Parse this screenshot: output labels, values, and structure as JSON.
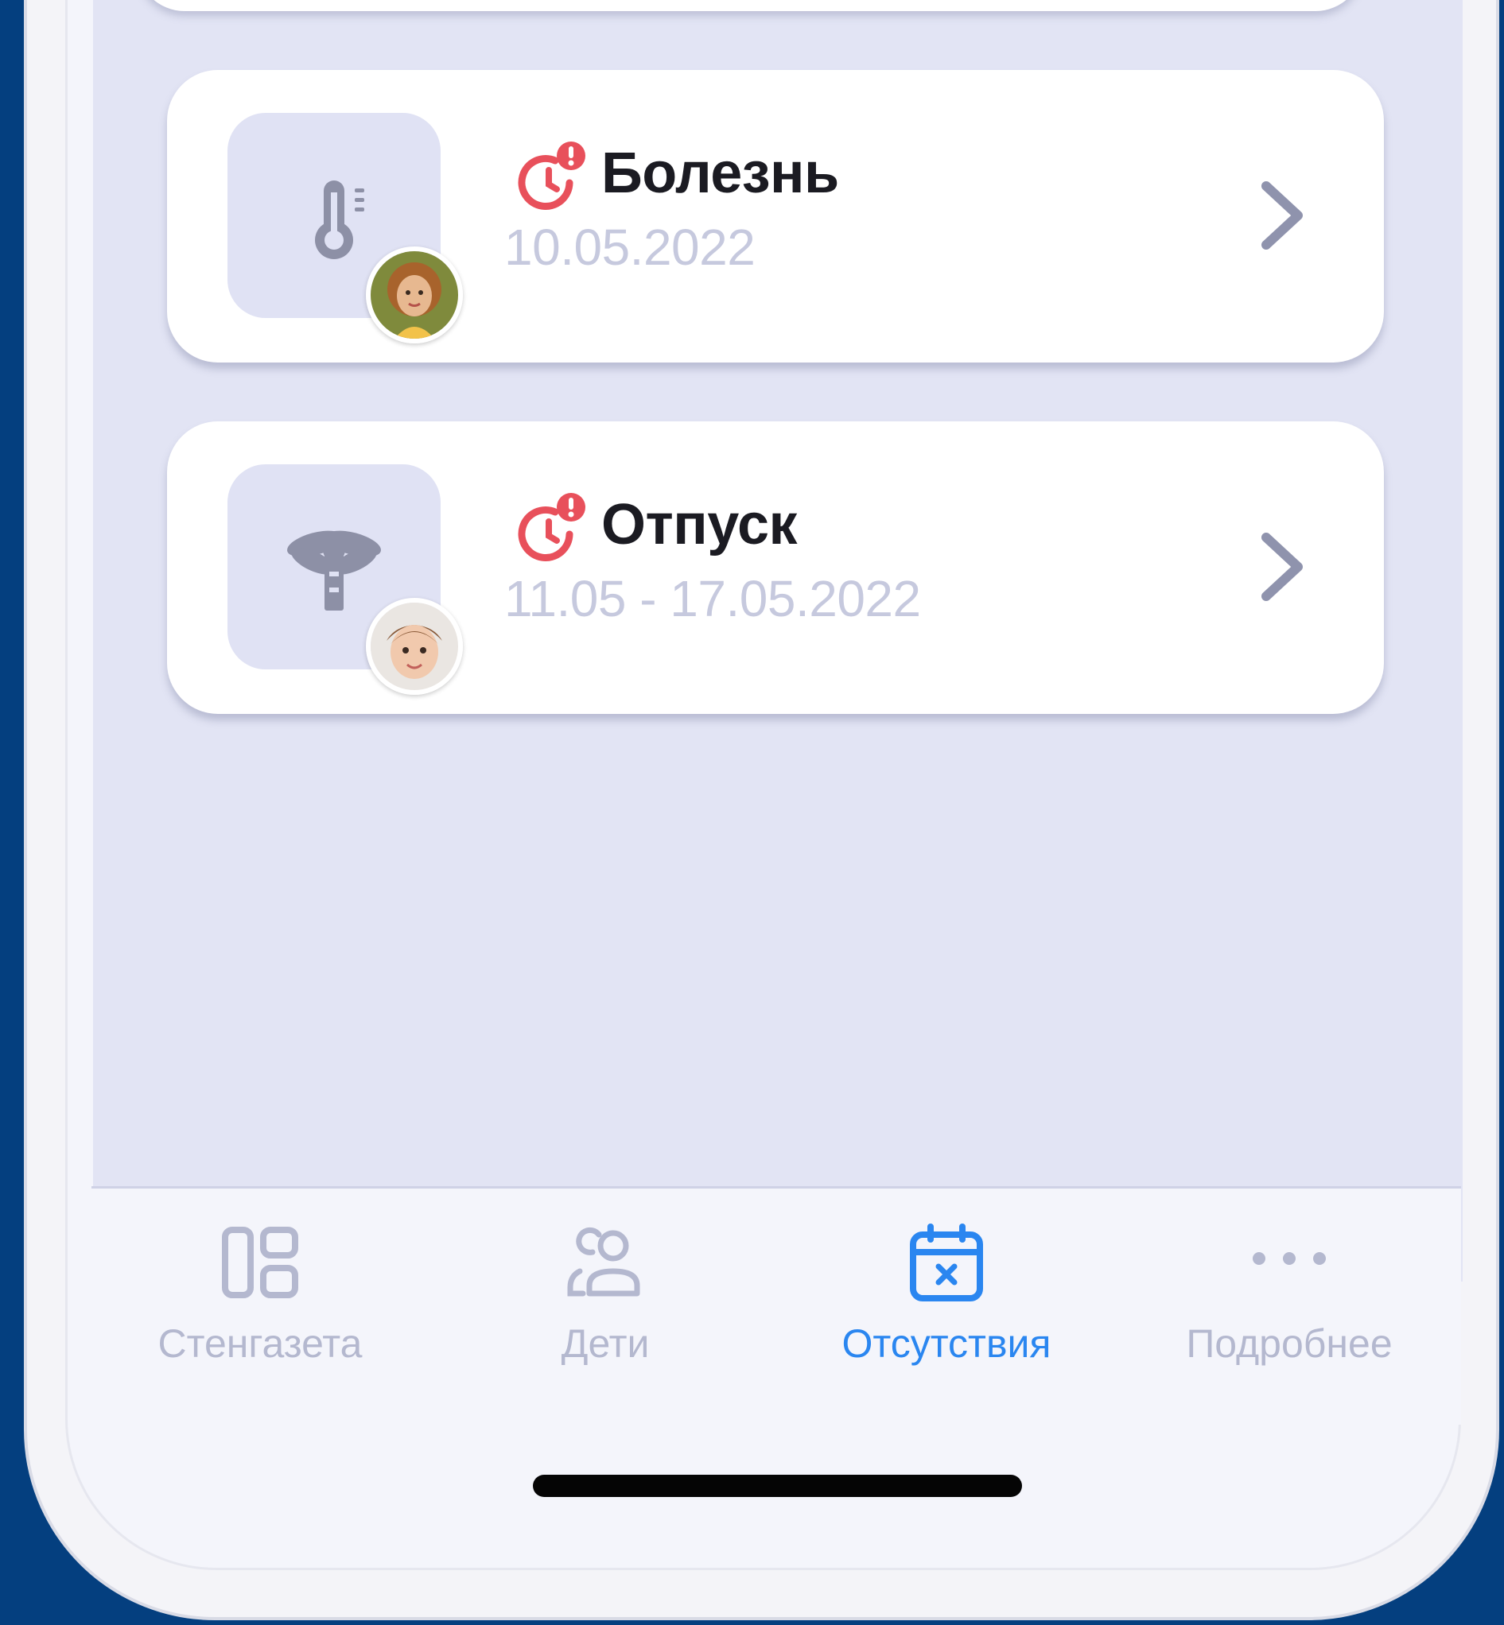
{
  "absences": [
    {
      "title": "Болезнь",
      "date": "10.05.2022",
      "type_icon": "thermometer-icon",
      "status_icon": "clock-alert-icon"
    },
    {
      "title": "Отпуск",
      "date": "11.05 - 17.05.2022",
      "type_icon": "palm-tree-icon",
      "status_icon": "clock-alert-icon"
    }
  ],
  "tabbar": {
    "items": [
      {
        "label": "Стенгазета",
        "icon": "dashboard-icon",
        "active": false
      },
      {
        "label": "Дети",
        "icon": "children-icon",
        "active": false
      },
      {
        "label": "Отсутствия",
        "icon": "calendar-x-icon",
        "active": true
      },
      {
        "label": "Подробнее",
        "icon": "more-dots-icon",
        "active": false
      }
    ]
  },
  "colors": {
    "background": "#043f7f",
    "screen": "#e2e4f4",
    "accent": "#2a86f0",
    "alert": "#e8505b",
    "muted_text": "#c6c9de",
    "tab_inactive": "#b4b8cf"
  }
}
